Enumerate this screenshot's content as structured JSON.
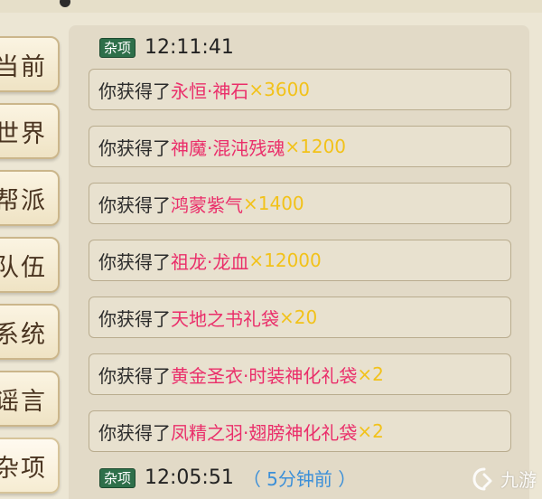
{
  "sidebar": {
    "tabs": [
      {
        "label": "当前",
        "active": false
      },
      {
        "label": "世界",
        "active": false
      },
      {
        "label": "帮派",
        "active": false
      },
      {
        "label": "队伍",
        "active": false
      },
      {
        "label": "系统",
        "active": false
      },
      {
        "label": "谣言",
        "active": false
      },
      {
        "label": "杂项",
        "active": true
      }
    ]
  },
  "chat": {
    "messages": [
      {
        "tag": "杂项",
        "time": "12:11:41",
        "items": [
          {
            "prefix": "你获得了",
            "name": "永恒·神石",
            "qty": "×3600"
          },
          {
            "prefix": "你获得了",
            "name": "神魔·混沌残魂",
            "qty": "×1200"
          },
          {
            "prefix": "你获得了",
            "name": "鸿蒙紫气",
            "qty": "×1400"
          },
          {
            "prefix": "你获得了",
            "name": "祖龙·龙血",
            "qty": "×12000"
          },
          {
            "prefix": "你获得了",
            "name": "天地之书礼袋",
            "qty": "×20"
          },
          {
            "prefix": "你获得了",
            "name": "黄金圣衣·时装神化礼袋",
            "qty": "×2"
          },
          {
            "prefix": "你获得了",
            "name": "凤精之羽·翅膀神化礼袋",
            "qty": "×2"
          }
        ]
      },
      {
        "tag": "杂项",
        "time": "12:05:51",
        "ago": "（ 5分钟前 ）"
      }
    ]
  },
  "colors": {
    "item_name": "#ea2e6a",
    "item_qty": "#f2c21a",
    "tag_bg": "#2e6f4a",
    "time_ago": "#3b8fd8"
  },
  "watermark": {
    "text": "九游",
    "icon": "jiuyou-logo-icon"
  }
}
